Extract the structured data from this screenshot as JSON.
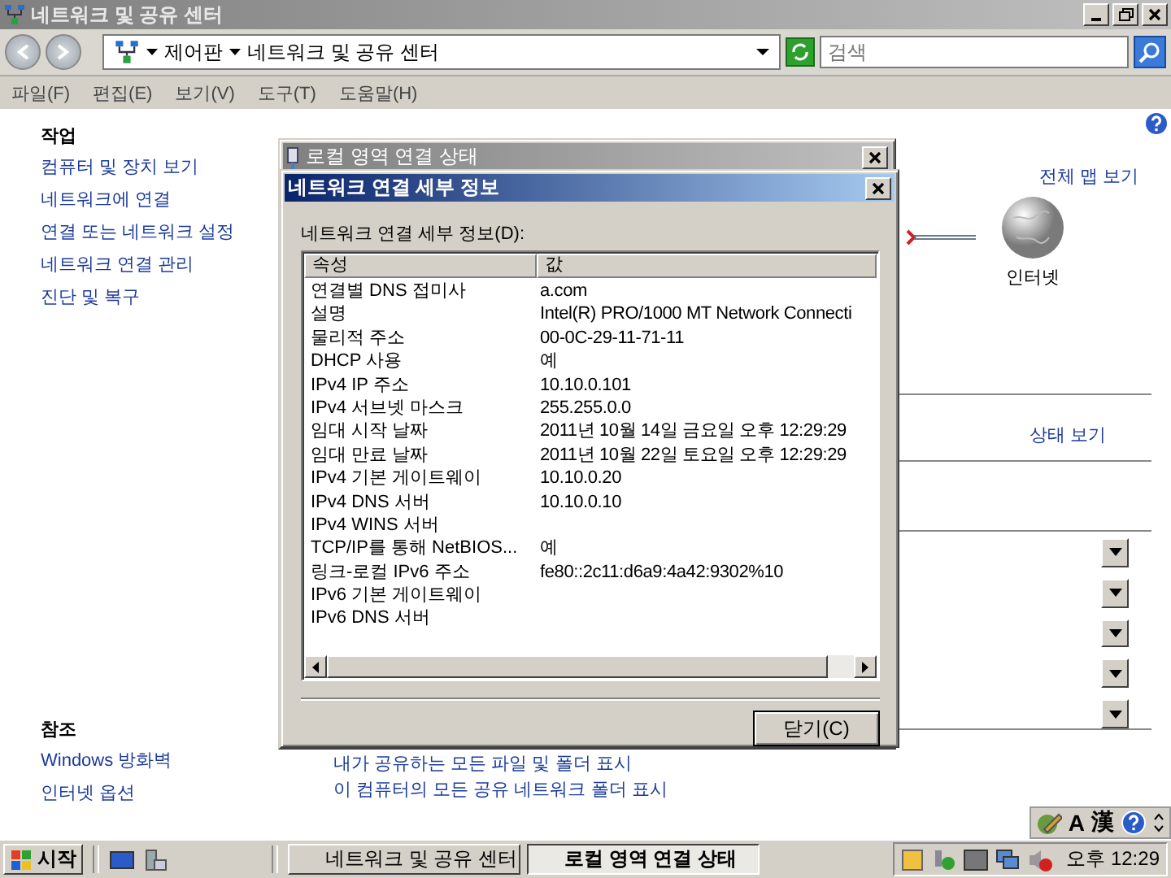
{
  "window": {
    "title": "네트워크 및 공유 센터"
  },
  "address_bar": {
    "path": [
      "제어판",
      "네트워크 및 공유 센터"
    ],
    "search": {
      "placeholder": "검색"
    }
  },
  "menu": [
    "파일(F)",
    "편집(E)",
    "보기(V)",
    "도구(T)",
    "도움말(H)"
  ],
  "sidebar": {
    "tasks": {
      "heading": "작업",
      "links": [
        "컴퓨터 및 장치 보기",
        "네트워크에 연결",
        "연결 또는 네트워크 설정",
        "네트워크 연결 관리",
        "진단 및 복구"
      ]
    },
    "see_also": {
      "heading": "참조",
      "links": [
        "Windows 방화벽",
        "인터넷 옵션"
      ]
    }
  },
  "main": {
    "map_link": "전체 맵 보기",
    "internet_label": "인터넷",
    "status_link": "상태 보기",
    "sharing_options": [
      {
        "expanded": false
      },
      {
        "expanded": false
      },
      {
        "expanded": false
      },
      {
        "expanded": false
      },
      {
        "expanded": false
      }
    ],
    "share_links": [
      "내가 공유하는 모든 파일 및 폴더 표시",
      "이 컴퓨터의 모든 공유 네트워크 폴더 표시"
    ]
  },
  "status_dialog": {
    "title": "로컬 영역 연결 상태"
  },
  "details_dialog": {
    "title": "네트워크 연결 세부 정보",
    "list_label": "네트워크 연결 세부 정보(D):",
    "columns": [
      "속성",
      "값"
    ],
    "rows": [
      {
        "property": "연결별 DNS 접미사",
        "value": "a.com"
      },
      {
        "property": "설명",
        "value": "Intel(R) PRO/1000 MT Network Connecti"
      },
      {
        "property": "물리적 주소",
        "value": "00-0C-29-11-71-11"
      },
      {
        "property": "DHCP 사용",
        "value": "예"
      },
      {
        "property": "IPv4 IP 주소",
        "value": "10.10.0.101"
      },
      {
        "property": "IPv4 서브넷 마스크",
        "value": "255.255.0.0"
      },
      {
        "property": "임대 시작 날짜",
        "value": "2011년 10월 14일 금요일 오후 12:29:29"
      },
      {
        "property": "임대 만료 날짜",
        "value": "2011년 10월 22일 토요일 오후 12:29:29"
      },
      {
        "property": "IPv4 기본 게이트웨이",
        "value": "10.10.0.20"
      },
      {
        "property": "IPv4 DNS 서버",
        "value": "10.10.0.10"
      },
      {
        "property": "IPv4 WINS 서버"
      },
      {
        "property": "TCP/IP를 통해 NetBIOS...",
        "value": "예"
      },
      {
        "property": "링크-로컬 IPv6 주소",
        "value": "fe80::2c11:d6a9:4a42:9302%10"
      },
      {
        "property": "IPv6 기본 게이트웨이"
      },
      {
        "property": "IPv6 DNS 서버"
      }
    ],
    "close_button": "닫기(C)"
  },
  "language_bar": {
    "mode": "A",
    "hanja": "漢"
  },
  "taskbar": {
    "start": "시작",
    "tasks": [
      {
        "label": "네트워크 및 공유 센터",
        "selected": false
      },
      {
        "label": "로컬 영역 연결 상태",
        "selected": true
      }
    ],
    "clock": "오후 12:29"
  }
}
